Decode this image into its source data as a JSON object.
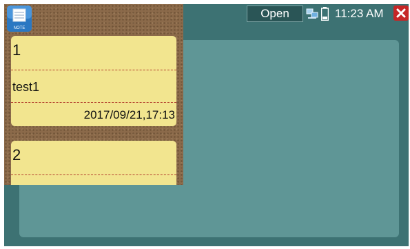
{
  "topbar": {
    "open_label": "Open",
    "time": "11:23 AM",
    "network_icon": "network-icon",
    "battery_icon": "battery-icon",
    "close_icon": "close-icon"
  },
  "app_icon": {
    "label": "NOTE",
    "name": "note-app-icon"
  },
  "notes": [
    {
      "number": "1",
      "text": "test1",
      "datetime": "2017/09/21,17:13"
    },
    {
      "number": "2"
    }
  ],
  "colors": {
    "screen_bg": "#3d7273",
    "panel_bg": "#5f9696",
    "card_bg": "#f2e58f",
    "divider": "#b13a2a",
    "close_red": "#c62626"
  }
}
